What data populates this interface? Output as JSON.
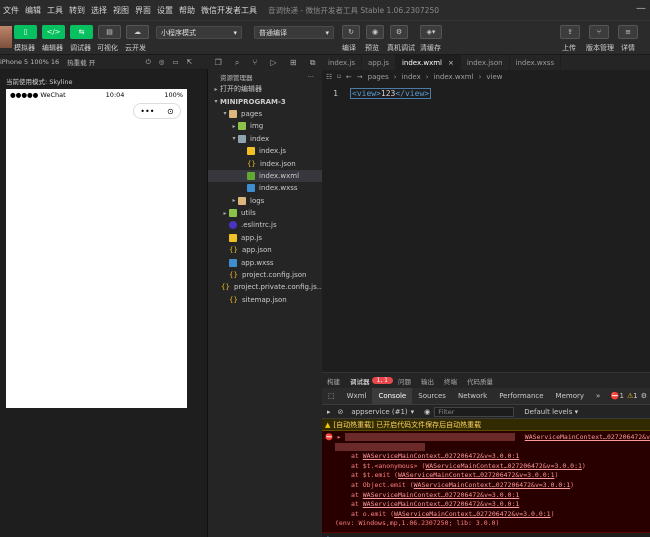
{
  "menubar": {
    "items": [
      "文件",
      "编辑",
      "工具",
      "转到",
      "选择",
      "视图",
      "界面",
      "设置",
      "帮助",
      "微信开发者工具"
    ],
    "window_title": "音调快递 - 微信开发者工具 Stable 1.06.2307250"
  },
  "toolbar": {
    "labels": [
      "模拟器",
      "编辑器",
      "调试器",
      "可视化",
      "云开发"
    ],
    "mode_select": "小程序模式",
    "compile_select": "普通编译",
    "right_labels": [
      "编译",
      "预览",
      "真机调试",
      "清缓存"
    ],
    "far_right_labels": [
      "上传",
      "版本管理",
      "详情"
    ]
  },
  "simulator": {
    "device": "iPhone 5 100% 16",
    "hotreload": "热重载 开",
    "title": "当前使用模式: Skyline",
    "status_carrier": "●●●●● WeChat",
    "status_time": "10:04",
    "status_battery": "100%"
  },
  "explorer": {
    "header": "资源管理器",
    "open_editors": "打开的编辑器",
    "project": "MINIPROGRAM-3",
    "tree": [
      {
        "label": "pages",
        "depth": 1,
        "kind": "folder",
        "arrow": "▾"
      },
      {
        "label": "img",
        "depth": 2,
        "kind": "folder-green",
        "arrow": "▸"
      },
      {
        "label": "index",
        "depth": 2,
        "kind": "folder-blue",
        "arrow": "▾"
      },
      {
        "label": "index.js",
        "depth": 3,
        "kind": "js",
        "arrow": ""
      },
      {
        "label": "index.json",
        "depth": 3,
        "kind": "json",
        "arrow": ""
      },
      {
        "label": "index.wxml",
        "depth": 3,
        "kind": "wxml",
        "arrow": "",
        "selected": true
      },
      {
        "label": "index.wxss",
        "depth": 3,
        "kind": "wxss",
        "arrow": ""
      },
      {
        "label": "logs",
        "depth": 2,
        "kind": "folder",
        "arrow": "▸"
      },
      {
        "label": "utils",
        "depth": 1,
        "kind": "folder-green",
        "arrow": "▸"
      },
      {
        "label": ".eslintrc.js",
        "depth": 1,
        "kind": "eslint",
        "arrow": ""
      },
      {
        "label": "app.js",
        "depth": 1,
        "kind": "js",
        "arrow": ""
      },
      {
        "label": "app.json",
        "depth": 1,
        "kind": "json",
        "arrow": ""
      },
      {
        "label": "app.wxss",
        "depth": 1,
        "kind": "wxss",
        "arrow": ""
      },
      {
        "label": "project.config.json",
        "depth": 1,
        "kind": "json",
        "arrow": ""
      },
      {
        "label": "project.private.config.js...",
        "depth": 1,
        "kind": "json",
        "arrow": ""
      },
      {
        "label": "sitemap.json",
        "depth": 1,
        "kind": "json",
        "arrow": ""
      }
    ]
  },
  "editor": {
    "tabs": [
      {
        "label": "index.js",
        "active": false
      },
      {
        "label": "app.js",
        "active": false
      },
      {
        "label": "index.wxml",
        "active": true
      },
      {
        "label": "index.json",
        "active": false
      },
      {
        "label": "index.wxss",
        "active": false
      }
    ],
    "breadcrumb": [
      "pages",
      "index",
      "index.wxml",
      "view"
    ],
    "line_number": "1",
    "code_open": "<view>",
    "code_text": "123",
    "code_close": "</view>"
  },
  "panel": {
    "tabs": [
      "构建",
      "调试器",
      "问题",
      "输出",
      "终端",
      "代码质量"
    ],
    "debugger_badge": "1, 1",
    "devtools_tabs": [
      "Wxml",
      "Console",
      "Sources",
      "Network",
      "Performance",
      "Memory"
    ],
    "more": "»",
    "error_count": "1",
    "warn_count": "1",
    "context": "appservice (#1)",
    "filter_placeholder": "Filter",
    "levels": "Default levels ▾",
    "warn_msg": "[自动热重载] 已开启代码文件保存后自动热重载",
    "err_head_link": "WAServiceMainContext…027206472&v=3.0",
    "stack": [
      {
        "pre": "at ",
        "link": "WAServiceMainContext…027206472&v=3.0.0:1",
        "post": ""
      },
      {
        "pre": "at $t.<anonymous> (",
        "link": "WAServiceMainContext…027206472&v=3.0.0:1",
        "post": ")"
      },
      {
        "pre": "at $t.emit (",
        "link": "WAServiceMainContext…027206472&v=3.0.0:1",
        "post": ")"
      },
      {
        "pre": "at Object.emit (",
        "link": "WAServiceMainContext…027206472&v=3.0.0:1",
        "post": ")"
      },
      {
        "pre": "at ",
        "link": "WAServiceMainContext…027206472&v=3.0.0:1",
        "post": ""
      },
      {
        "pre": "at ",
        "link": "WAServiceMainContext…027206472&v=3.0.0:1",
        "post": ""
      },
      {
        "pre": "at o.emit (",
        "link": "WAServiceMainContext…027206472&v=3.0.0:1",
        "post": ")"
      }
    ],
    "env_line": "(env: Windows,mp,1.06.2307250; lib: 3.0.0)",
    "prompt": "›"
  }
}
